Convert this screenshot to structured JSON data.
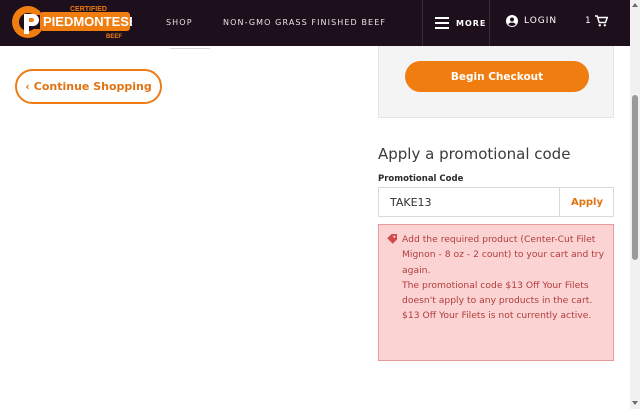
{
  "brand": {
    "logo_top": "CERTIFIED",
    "logo_main": "PIEDMONTESE",
    "logo_bottom": "BEEF"
  },
  "nav": {
    "shop": "SHOP",
    "tagline": "NON-GMO GRASS FINISHED BEEF",
    "more": "MORE",
    "login": "LOGIN",
    "cart_count": "1"
  },
  "left": {
    "continue_label": "Continue Shopping"
  },
  "summary": {
    "checkout_label": "Begin Checkout"
  },
  "promo": {
    "title": "Apply a promotional code",
    "field_label": "Promotional Code",
    "value": "TAKE13",
    "apply_label": "Apply",
    "errors": [
      "Add the required product (Center-Cut Filet Mignon - 8 oz - 2 count) to your cart and try again.",
      "The promotional code $13 Off Your Filets doesn't apply to any products in the cart.",
      "$13 Off Your Filets is not currently active."
    ]
  },
  "colors": {
    "accent": "#f07d10",
    "nav_bg": "#1d0f1b",
    "error_bg": "#fbd3d3",
    "error_text": "#b23d3d"
  },
  "icons": {
    "menu": "hamburger-icon",
    "login": "account-circle-icon",
    "cart": "shopping-cart-icon",
    "error": "tag-icon"
  }
}
